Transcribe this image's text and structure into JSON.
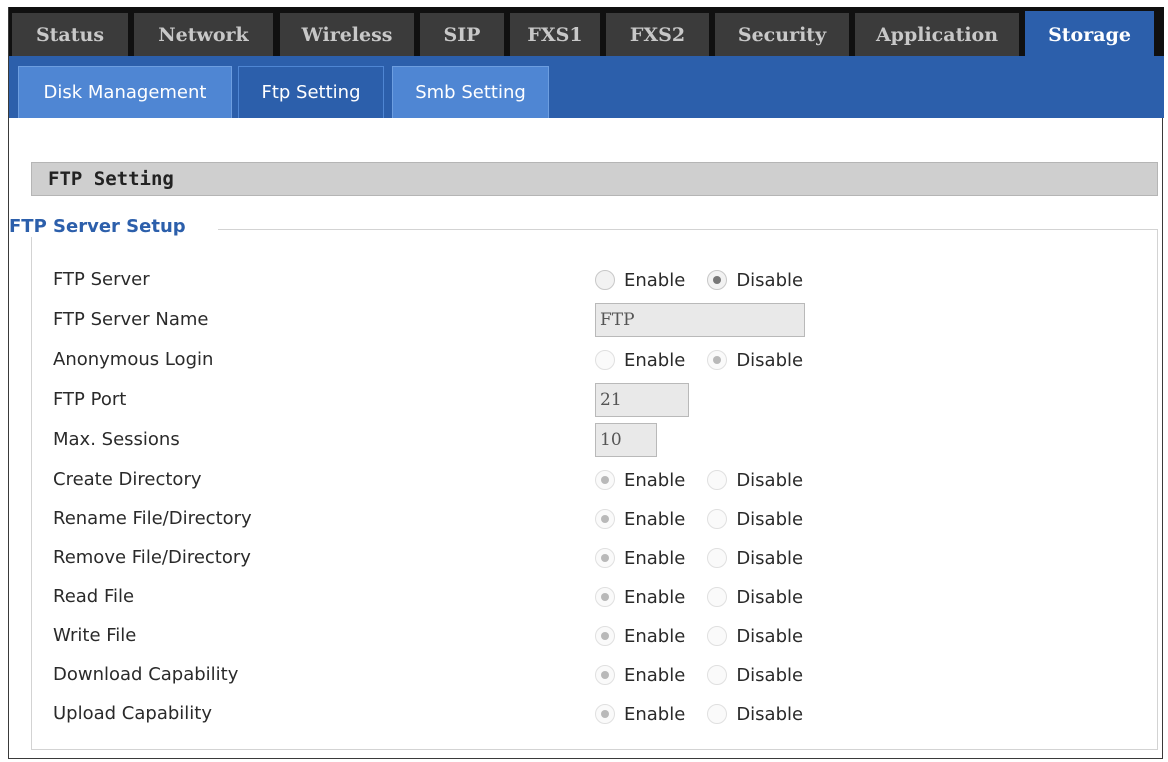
{
  "top_tabs": [
    {
      "label": "Status",
      "active": false
    },
    {
      "label": "Network",
      "active": false
    },
    {
      "label": "Wireless",
      "active": false
    },
    {
      "label": "SIP",
      "active": false
    },
    {
      "label": "FXS1",
      "active": false
    },
    {
      "label": "FXS2",
      "active": false
    },
    {
      "label": "Security",
      "active": false
    },
    {
      "label": "Application",
      "active": false
    },
    {
      "label": "Storage",
      "active": true
    }
  ],
  "sub_tabs": [
    {
      "label": "Disk Management",
      "active": false
    },
    {
      "label": "Ftp Setting",
      "active": true
    },
    {
      "label": "Smb Setting",
      "active": false
    }
  ],
  "section_title": "FTP Setting",
  "group_legend": "FTP Server Setup",
  "option_labels": {
    "enable": "Enable",
    "disable": "Disable"
  },
  "fields": [
    {
      "label": "FTP Server",
      "type": "radio",
      "value": "Disable"
    },
    {
      "label": "FTP Server Name",
      "type": "text",
      "value": "FTP"
    },
    {
      "label": "Anonymous Login",
      "type": "radio",
      "value": "Disable",
      "disabled": true
    },
    {
      "label": "FTP Port",
      "type": "text",
      "value": "21"
    },
    {
      "label": "Max. Sessions",
      "type": "text",
      "value": "10"
    },
    {
      "label": "Create Directory",
      "type": "radio",
      "value": "Enable",
      "disabled": true
    },
    {
      "label": "Rename File/Directory",
      "type": "radio",
      "value": "Enable",
      "disabled": true
    },
    {
      "label": "Remove File/Directory",
      "type": "radio",
      "value": "Enable",
      "disabled": true
    },
    {
      "label": "Read File",
      "type": "radio",
      "value": "Enable",
      "disabled": true
    },
    {
      "label": "Write File",
      "type": "radio",
      "value": "Enable",
      "disabled": true
    },
    {
      "label": "Download Capability",
      "type": "radio",
      "value": "Enable",
      "disabled": true
    },
    {
      "label": "Upload Capability",
      "type": "radio",
      "value": "Enable",
      "disabled": true
    }
  ],
  "colors": {
    "active_tab": "#2c5fab",
    "sub_tab": "#4f86d3",
    "legend": "#2c5fab"
  }
}
